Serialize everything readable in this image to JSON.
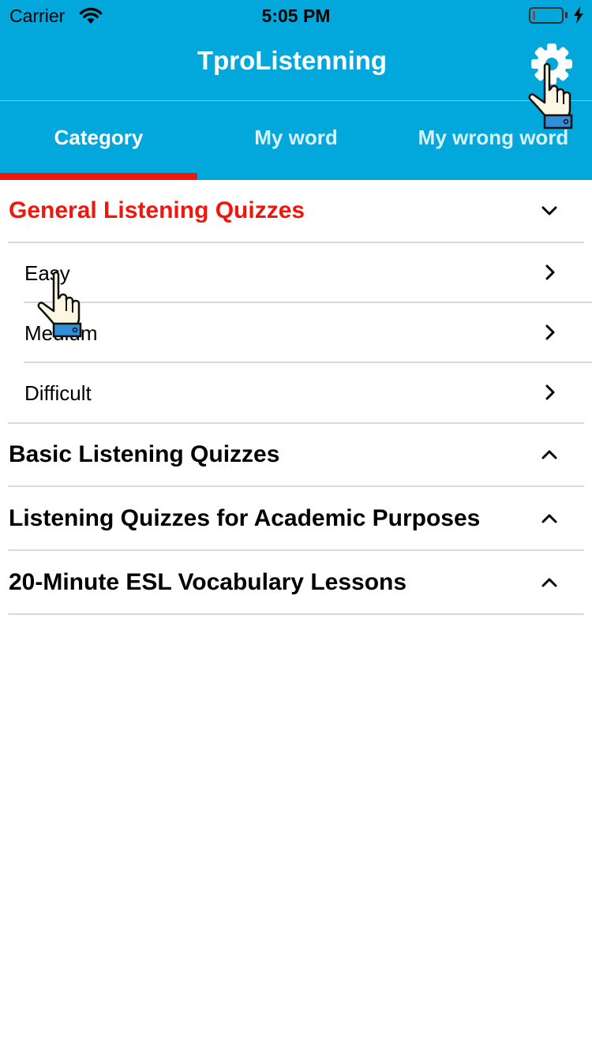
{
  "status_bar": {
    "carrier": "Carrier",
    "time": "5:05 PM"
  },
  "app": {
    "title": "TproListenning"
  },
  "icons": {
    "settings": "gear-icon",
    "wifi": "wifi-icon",
    "battery": "battery-icon",
    "charging": "bolt-icon",
    "pointer": "pointing-hand-icon"
  },
  "tabs": [
    {
      "label": "Category",
      "selected": true
    },
    {
      "label": "My word",
      "selected": false
    },
    {
      "label": "My wrong word",
      "selected": false
    }
  ],
  "sections": [
    {
      "title": "General Listening Quizzes",
      "expanded": true,
      "items": [
        {
          "label": "Easy"
        },
        {
          "label": "Medium"
        },
        {
          "label": "Difficult"
        }
      ]
    },
    {
      "title": "Basic Listening Quizzes",
      "expanded": false
    },
    {
      "title": "Listening Quizzes for Academic Purposes",
      "expanded": false
    },
    {
      "title": "20-Minute ESL Vocabulary Lessons",
      "expanded": false
    }
  ],
  "colors": {
    "header": "#02a8dc",
    "accent": "#f0160d",
    "divider": "#d9d9d9"
  }
}
